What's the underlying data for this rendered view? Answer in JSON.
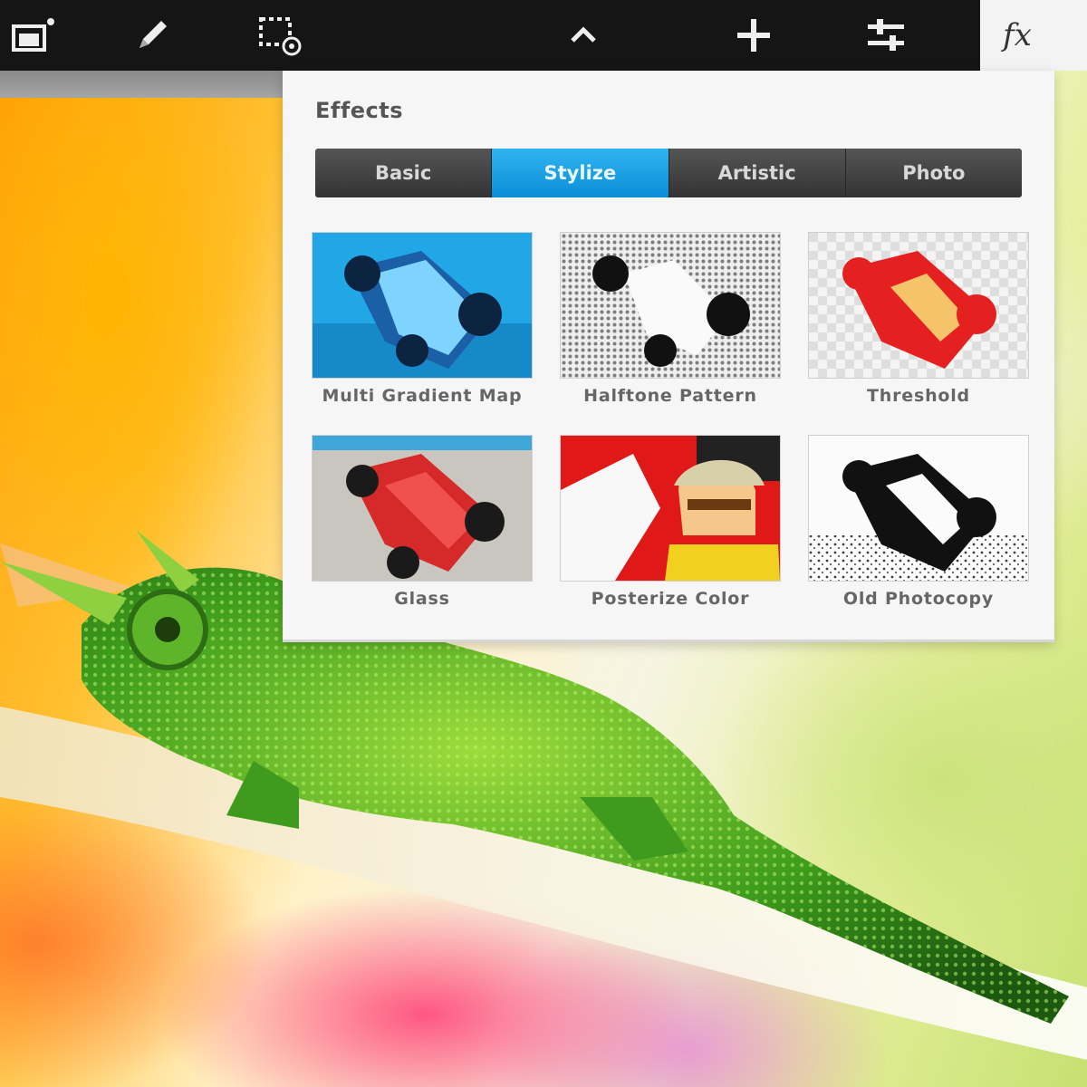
{
  "toolbar": {
    "buttons": [
      {
        "name": "image-icon"
      },
      {
        "name": "pencil-icon"
      },
      {
        "name": "selection-icon"
      },
      {
        "name": "chevron-up-icon"
      },
      {
        "name": "plus-icon"
      },
      {
        "name": "sliders-icon"
      }
    ],
    "fx_label": "fx"
  },
  "effects_panel": {
    "title": "Effects",
    "tabs": [
      {
        "label": "Basic",
        "active": false
      },
      {
        "label": "Stylize",
        "active": true
      },
      {
        "label": "Artistic",
        "active": false
      },
      {
        "label": "Photo",
        "active": false
      }
    ],
    "effects": [
      {
        "label": "Multi Gradient Map"
      },
      {
        "label": "Halftone Pattern"
      },
      {
        "label": "Threshold"
      },
      {
        "label": "Glass"
      },
      {
        "label": "Posterize Color"
      },
      {
        "label": "Old Photocopy"
      }
    ]
  },
  "colors": {
    "toolbar_bg": "#151515",
    "active_tab": "#1aa0e4",
    "panel_bg": "#f6f6f6"
  }
}
